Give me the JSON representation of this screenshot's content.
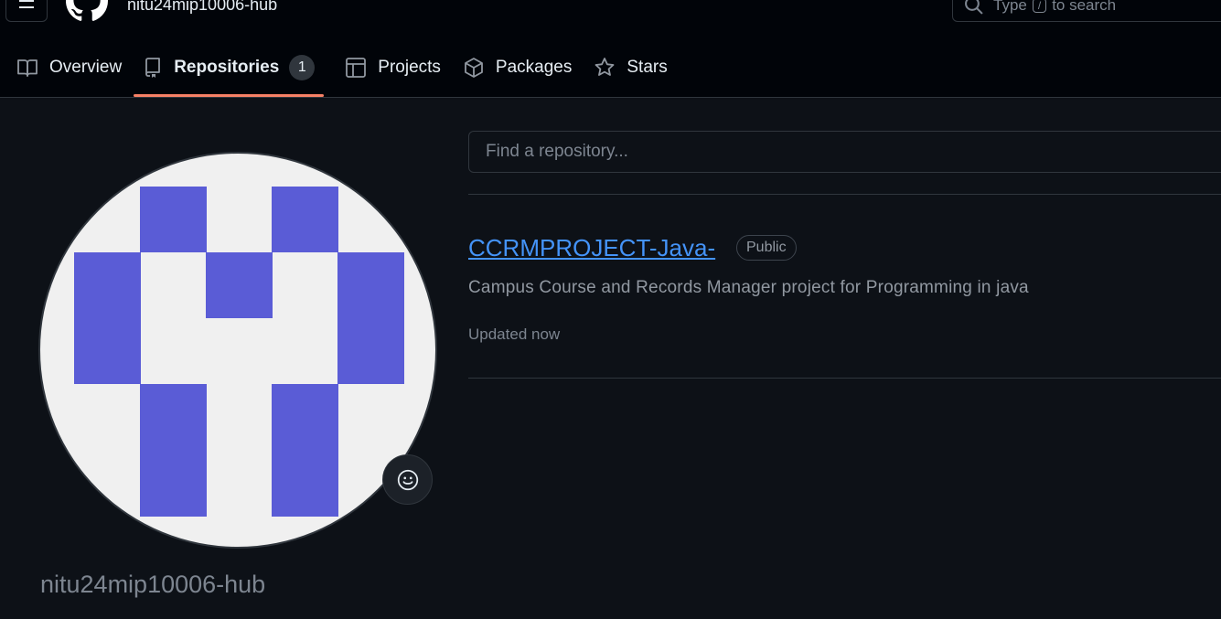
{
  "header": {
    "title": "nitu24mip10006-hub",
    "search": {
      "prefix": "Type",
      "key": "/",
      "suffix": "to search"
    }
  },
  "tabs": [
    {
      "label": "Overview",
      "icon": "book-icon"
    },
    {
      "label": "Repositories",
      "icon": "repo-icon",
      "count": "1",
      "active": true
    },
    {
      "label": "Projects",
      "icon": "table-icon"
    },
    {
      "label": "Packages",
      "icon": "package-icon"
    },
    {
      "label": "Stars",
      "icon": "star-icon"
    }
  ],
  "profile": {
    "username": "nitu24mip10006-hub",
    "avatar_colors": {
      "background": "#f0f0f0",
      "foreground": "#5a5cd6"
    }
  },
  "repo_list": {
    "search_placeholder": "Find a repository...",
    "items": [
      {
        "name": "CCRMPROJECT-Java-",
        "visibility": "Public",
        "description": "Campus Course and Records Manager project for Programming in java",
        "updated": "Updated now"
      }
    ]
  },
  "colors": {
    "accent_underline": "#f78166",
    "link": "#4493f8",
    "background": "#0d1117",
    "header_background": "#010409"
  }
}
